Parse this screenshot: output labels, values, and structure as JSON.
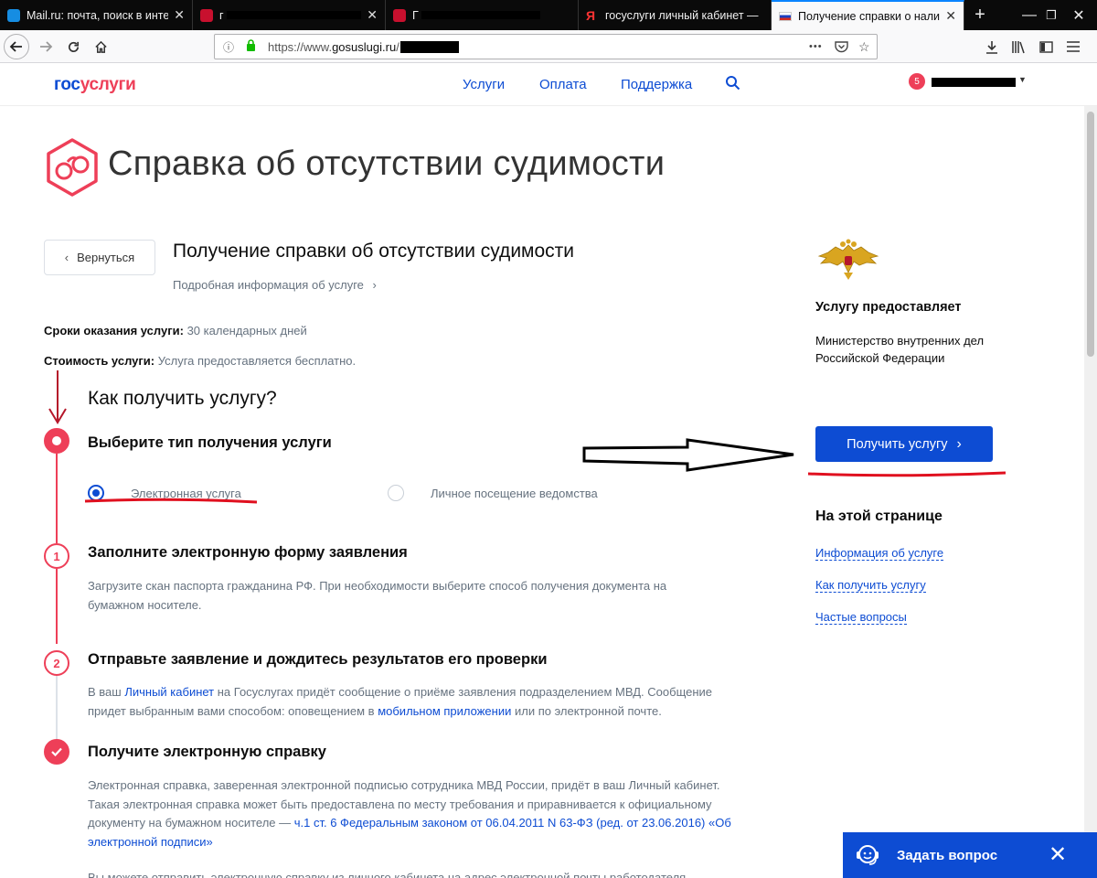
{
  "browser": {
    "tabs": [
      {
        "label": "Mail.ru: почта, поиск в интерн"
      },
      {
        "label": "г"
      },
      {
        "label": "Г"
      },
      {
        "label": "госуслуги личный кабинет —"
      },
      {
        "label": "Получение справки о налич",
        "active": true
      }
    ],
    "new_tab_symbol": "+",
    "url_prefix": "https://www.",
    "url_domain": "gosuslugi.ru",
    "url_suffix": "/",
    "menu_dots": "•••"
  },
  "header": {
    "logo_part1": "гос",
    "logo_part2": "услуги",
    "nav": [
      {
        "label": "Услуги"
      },
      {
        "label": "Оплата"
      },
      {
        "label": "Поддержка"
      }
    ],
    "notifications_count": "5"
  },
  "page": {
    "title": "Справка об отсутствии судимости",
    "back_label": "Вернуться",
    "service_title": "Получение справки об отсутствии судимости",
    "service_details_link": "Подробная информация об услуге",
    "terms_label": "Сроки оказания услуги:",
    "terms_value": " 30 календарных дней",
    "cost_label": "Стоимость услуги:",
    "cost_value": " Услуга предоставляется бесплатно.",
    "how_title": "Как получить услугу?"
  },
  "steps": {
    "step0_title": "Выберите тип получения услуги",
    "option_electronic": "Электронная услуга",
    "option_visit": "Личное посещение ведомства",
    "step1_num": "1",
    "step1_title": "Заполните электронную форму заявления",
    "step1_body": "Загрузите скан паспорта гражданина РФ. При необходимости выберите способ получения документа на бумажном носителе.",
    "step2_num": "2",
    "step2_title": "Отправьте заявление и дождитесь результатов его проверки",
    "step2_body_1": "В ваш ",
    "step2_link_1": "Личный кабинет",
    "step2_body_2": " на Госуслугах придёт сообщение о приёме заявления подразделением МВД. Сообщение придет выбранным вами способом: оповещением в ",
    "step2_link_2": "мобильном приложении",
    "step2_body_3": " или по электронной почте.",
    "step3_title": "Получите электронную справку",
    "step3_body_1": "Электронная справка, заверенная электронной подписью сотрудника МВД России, придёт в ваш Личный кабинет. Такая электронная справка может быть предоставлена по месту требования и приравнивается к официальному документу на бумажном носителе — ",
    "step3_link": "ч.1 ст. 6 Федеральным законом от 06.04.2011 N 63-ФЗ (ред. от 23.06.2016) «Об электронной подписи»",
    "step3_more": "Вы можете отправить электронную справку из личного кабинета на адрес электронной почты работодателя —"
  },
  "sidebar": {
    "provider_heading": "Услугу предоставляет",
    "provider_name": "Министерство внутренних дел Российской Федерации",
    "get_service_button": "Получить услугу",
    "on_page_heading": "На этой странице",
    "links": [
      {
        "label": "Информация об услуге"
      },
      {
        "label": "Как получить услугу"
      },
      {
        "label": "Частые вопросы"
      }
    ]
  },
  "chat": {
    "label": "Задать вопрос"
  },
  "colors": {
    "brand_blue": "#0d4cd3",
    "brand_red": "#ee3f58",
    "annotation_red": "#e0101f"
  },
  "icons": [
    "back-arrow-icon",
    "forward-arrow-icon",
    "reload-icon",
    "home-icon",
    "info-icon",
    "lock-icon",
    "pocket-icon",
    "star-icon",
    "download-icon",
    "library-icon",
    "sidebar-icon",
    "hamburger-icon",
    "search-icon",
    "handcuffs-icon",
    "emblem-icon",
    "chat-operator-icon",
    "close-icon"
  ]
}
